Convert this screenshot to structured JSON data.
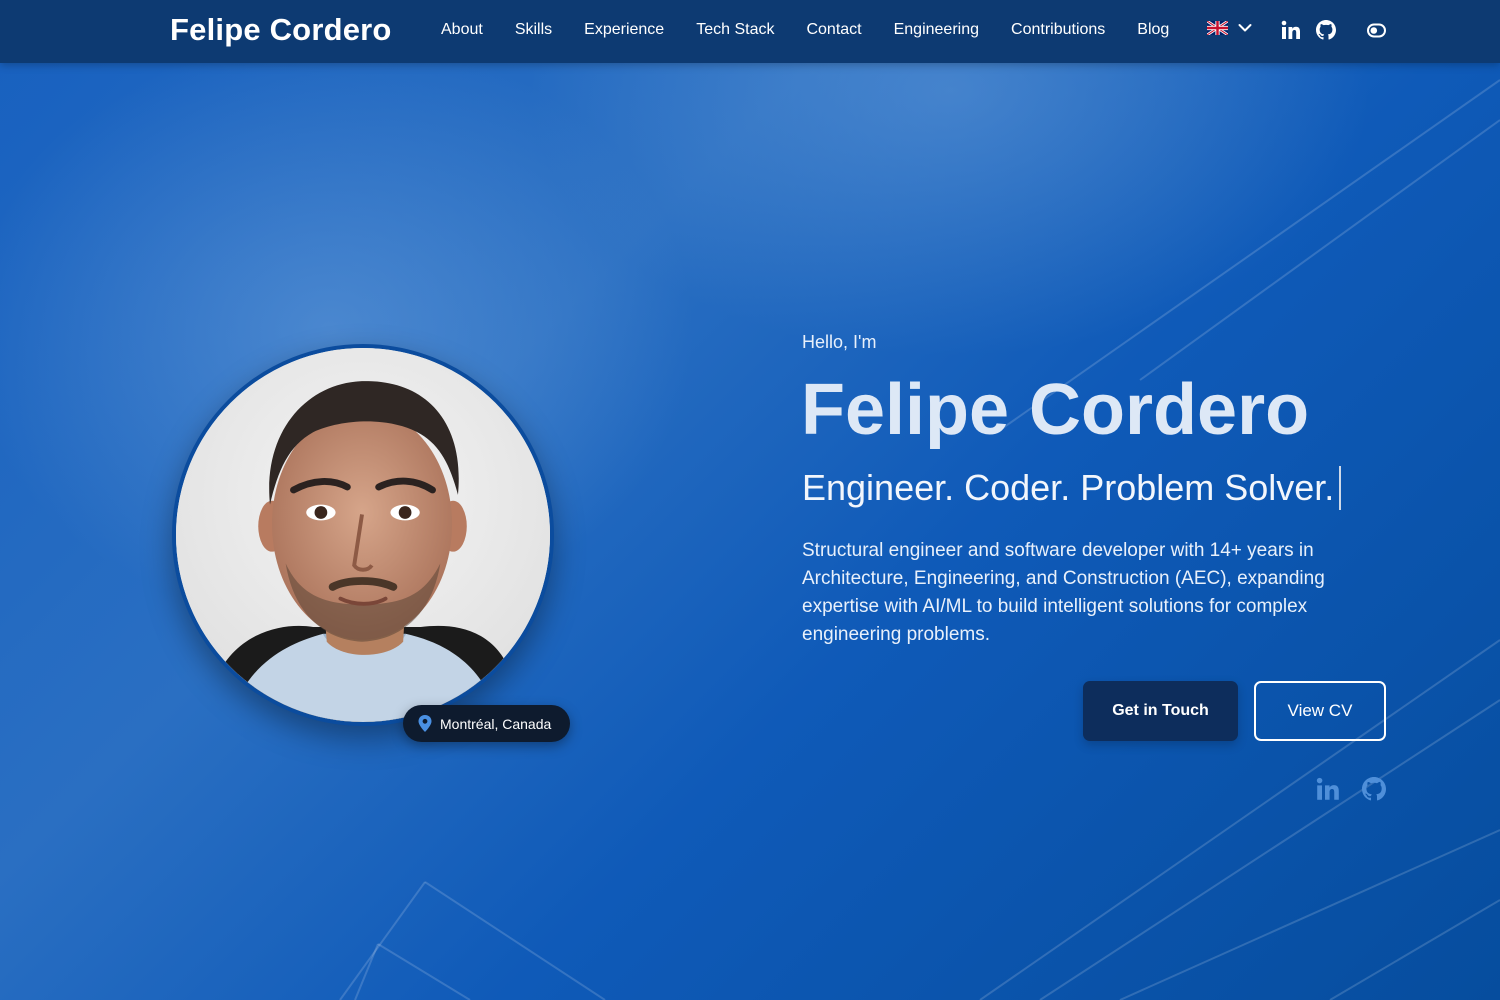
{
  "navbar": {
    "brand": "Felipe Cordero",
    "links": [
      {
        "label": "About"
      },
      {
        "label": "Skills"
      },
      {
        "label": "Experience"
      },
      {
        "label": "Tech Stack"
      },
      {
        "label": "Contact"
      },
      {
        "label": "Engineering"
      },
      {
        "label": "Contributions"
      },
      {
        "label": "Blog"
      }
    ],
    "language": {
      "flag_icon": "uk-flag-icon",
      "dropdown_icon": "chevron-down-icon"
    },
    "icons": [
      "linkedin-icon",
      "github-icon",
      "theme-toggle-icon"
    ]
  },
  "profile": {
    "photo_icon": "profile-photo",
    "location": "Montréal, Canada",
    "location_icon": "map-pin-icon"
  },
  "hero": {
    "greeting": "Hello, I'm",
    "name": "Felipe Cordero",
    "tagline": "Engineer. Coder. Problem Solver.",
    "intro": "Structural engineer and software developer with 14+ years in Architecture, Engineering, and Construction (AEC), expanding expertise with AI/ML to build intelligent solutions for complex engineering problems.",
    "primary_button": "Get in Touch",
    "secondary_button": "View CV",
    "social_icons": [
      "linkedin-icon",
      "github-icon"
    ]
  },
  "colors": {
    "navbar_bg": "#0d3a72",
    "hero_bg": "#1760bf",
    "primary_button_bg": "#0d2d5c",
    "badge_bg": "#0e1b2e",
    "pin_accent": "#4a90e2"
  }
}
